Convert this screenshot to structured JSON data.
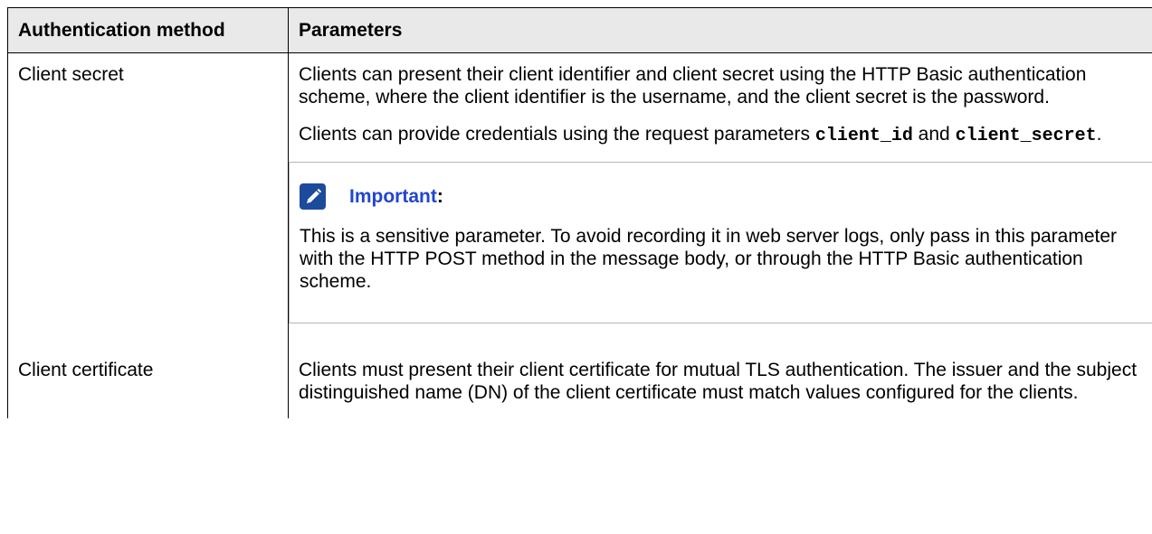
{
  "table": {
    "headers": [
      "Authentication method",
      "Parameters"
    ],
    "rows": [
      {
        "method": "Client secret",
        "p1": "Clients can present their client identifier and client secret using the HTTP Basic authentication scheme, where the client identifier is the username, and the client secret is the password.",
        "p2_before": "Clients can provide credentials using the request parameters ",
        "p2_code1": "client_id",
        "p2_between": " and ",
        "p2_code2": "client_secret",
        "p2_after": ".",
        "note": {
          "icon": "pencil-note-icon",
          "title": "Important",
          "colon": ":",
          "text": "This is a sensitive parameter. To avoid recording it in web server logs, only pass in this parameter with the HTTP POST method in the message body, or through the HTTP Basic authentication scheme."
        }
      },
      {
        "method": "Client certificate",
        "p1": "Clients must present their client certificate for mutual TLS authentication. The issuer and the subject distinguished name (DN) of the client certificate must match values configured for the clients."
      }
    ]
  },
  "colors": {
    "header_bg": "#e9e9e9",
    "note_title": "#2145d1",
    "note_icon_bg": "#1d4b9b"
  }
}
